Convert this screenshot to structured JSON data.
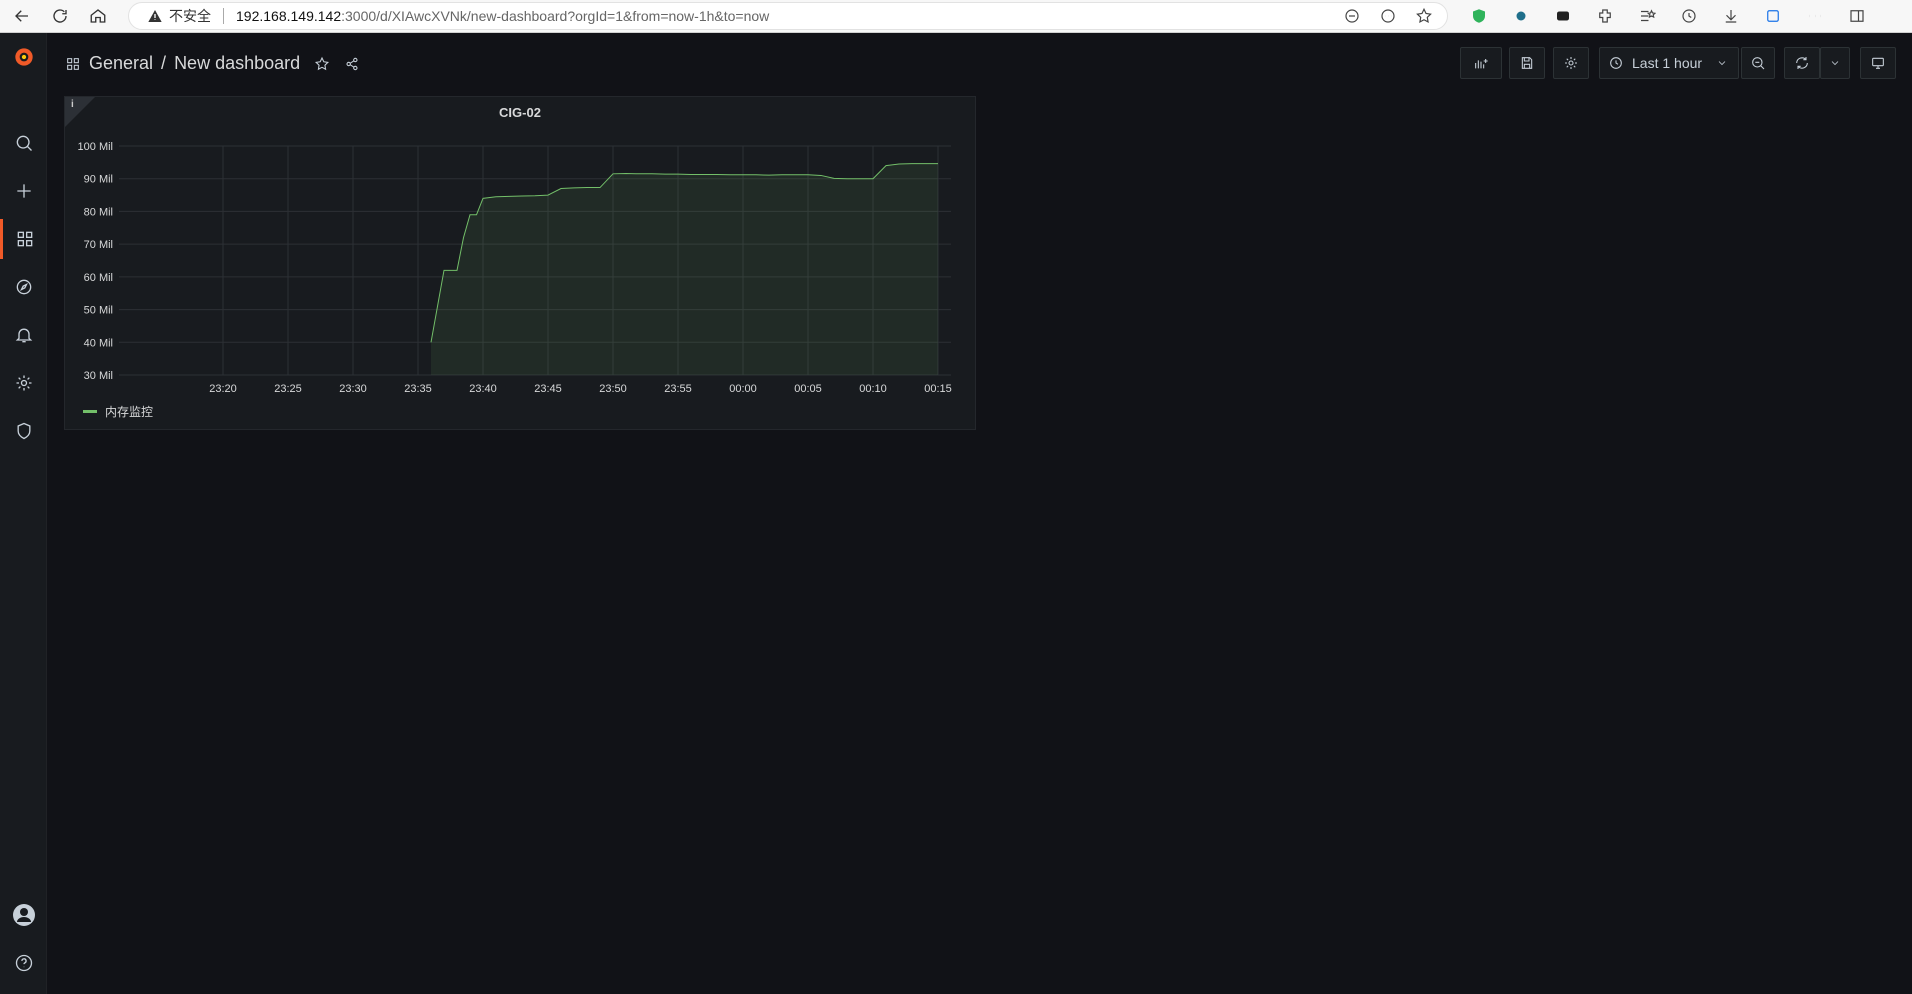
{
  "browser": {
    "security_label": "不安全",
    "url_host": "192.168.149.142",
    "url_path": ":3000/d/XIAwcXVNk/new-dashboard?orgId=1&from=now-1h&to=now"
  },
  "header": {
    "folder": "General",
    "separator": "/",
    "dashboard_title": "New dashboard",
    "time_range_label": "Last 1 hour"
  },
  "panel": {
    "title": "CIG-02",
    "info_glyph": "i"
  },
  "colors": {
    "accent": "#f05a28",
    "series": "#73bf69",
    "background": "#111217"
  },
  "chart_data": {
    "type": "line",
    "title": "CIG-02",
    "xlabel": "",
    "ylabel": "",
    "x_ticks": [
      "23:20",
      "23:25",
      "23:30",
      "23:35",
      "23:40",
      "23:45",
      "23:50",
      "23:55",
      "00:00",
      "00:05",
      "00:10",
      "00:15"
    ],
    "y_ticks": [
      "30 Mil",
      "40 Mil",
      "50 Mil",
      "60 Mil",
      "70 Mil",
      "80 Mil",
      "90 Mil",
      "100 Mil"
    ],
    "y_tick_values": [
      30,
      40,
      50,
      60,
      70,
      80,
      90,
      100
    ],
    "ylim": [
      30,
      100
    ],
    "xlim_minutes": [
      "23:12",
      "00:16"
    ],
    "grid": true,
    "fill_under_line": true,
    "legend_placement": "bottom-left",
    "series": [
      {
        "name": "内存监控",
        "x": [
          "23:36",
          "23:36:30",
          "23:37",
          "23:37:30",
          "23:38",
          "23:38:30",
          "23:39",
          "23:39:30",
          "23:40",
          "23:41",
          "23:42",
          "23:43",
          "23:44",
          "23:45",
          "23:46",
          "23:47",
          "23:48",
          "23:49",
          "23:50",
          "23:51",
          "23:52",
          "23:53",
          "23:54",
          "23:55",
          "23:56",
          "23:57",
          "23:58",
          "23:59",
          "00:00",
          "00:01",
          "00:02",
          "00:03",
          "00:04",
          "00:05",
          "00:06",
          "00:07",
          "00:08",
          "00:09",
          "00:10",
          "00:11",
          "00:12",
          "00:13",
          "00:14",
          "00:15"
        ],
        "values": [
          40,
          51,
          62,
          62,
          62,
          72,
          79,
          79,
          84,
          84.5,
          84.6,
          84.7,
          84.8,
          85,
          87,
          87.2,
          87.3,
          87.3,
          91.5,
          91.6,
          91.5,
          91.5,
          91.4,
          91.4,
          91.3,
          91.3,
          91.3,
          91.2,
          91.2,
          91.2,
          91.1,
          91.2,
          91.2,
          91.2,
          91,
          90.1,
          90,
          90,
          90,
          94,
          94.5,
          94.6,
          94.6,
          94.6
        ]
      }
    ]
  }
}
